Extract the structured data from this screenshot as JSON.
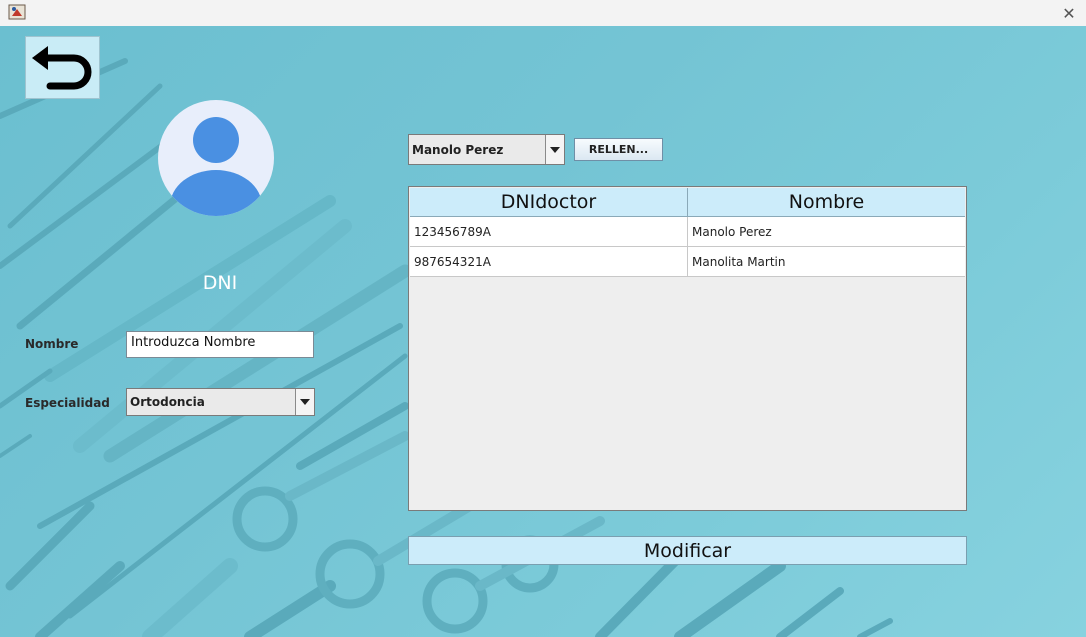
{
  "window": {
    "close_glyph": "✕"
  },
  "form": {
    "dni_label": "DNI",
    "name_label": "Nombre",
    "name_value": "Introduzca Nombre",
    "specialty_label": "Especialidad",
    "specialty_value": "Ortodoncia"
  },
  "doctor_selector": {
    "selected": "Manolo Perez",
    "fill_button_label": "RELLEN..."
  },
  "doctors_table": {
    "columns": [
      "DNIdoctor",
      "Nombre"
    ],
    "rows": [
      [
        "123456789A",
        "Manolo Perez"
      ],
      [
        "987654321A",
        "Manolita Martin"
      ]
    ]
  },
  "actions": {
    "modify_label": "Modificar"
  },
  "icons": {
    "back": "back-arrow-icon",
    "avatar": "user-avatar-icon",
    "app": "java-app-icon"
  },
  "colors": {
    "background_teal": "#74c4d4",
    "light_blue_button": "#ccecfa",
    "avatar_blue": "#4a90e2"
  }
}
